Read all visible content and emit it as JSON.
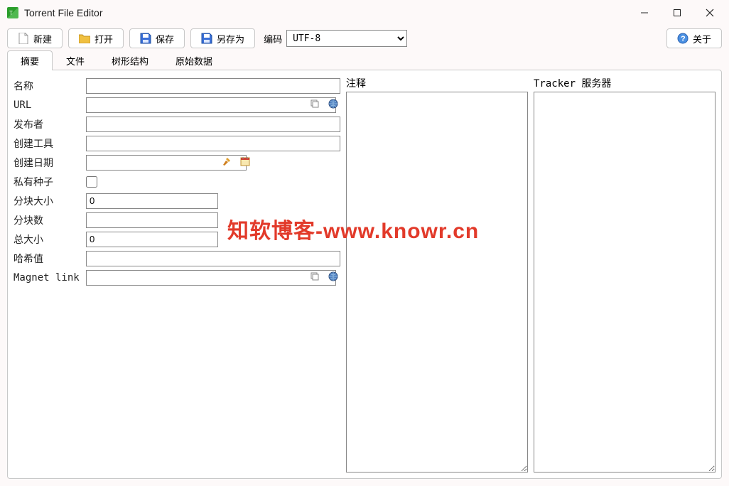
{
  "window": {
    "title": "Torrent File Editor"
  },
  "toolbar": {
    "new_label": "新建",
    "open_label": "打开",
    "save_label": "保存",
    "saveas_label": "另存为",
    "encoding_label": "编码",
    "encoding_value": "UTF-8",
    "about_label": "关于"
  },
  "tabs": {
    "summary": "摘要",
    "files": "文件",
    "tree": "树形结构",
    "raw": "原始数据"
  },
  "fields": {
    "name_label": "名称",
    "name_value": "",
    "url_label": "URL",
    "url_value": "",
    "publisher_label": "发布者",
    "publisher_value": "",
    "creator_label": "创建工具",
    "creator_value": "",
    "date_label": "创建日期",
    "date_value": "",
    "private_label": "私有种子",
    "private_value": false,
    "piecesize_label": "分块大小",
    "piecesize_value": "0",
    "pieces_label": "分块数",
    "pieces_value": "",
    "totalsize_label": "总大小",
    "totalsize_value": "0",
    "hash_label": "哈希值",
    "hash_value": "",
    "magnet_label": "Magnet link",
    "magnet_value": ""
  },
  "panels": {
    "comment_label": "注释",
    "trackers_label": "Tracker 服务器"
  },
  "watermark": "知软博客-www.knowr.cn"
}
